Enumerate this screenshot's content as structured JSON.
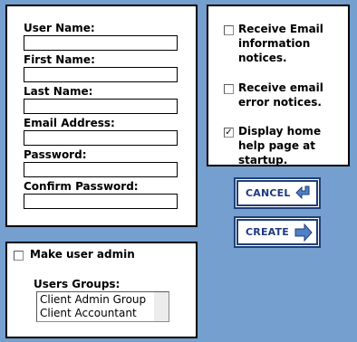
{
  "user_form": {
    "fields": [
      {
        "label": "User Name:",
        "value": ""
      },
      {
        "label": "First Name:",
        "value": ""
      },
      {
        "label": "Last Name:",
        "value": ""
      },
      {
        "label": "Email Address:",
        "value": ""
      },
      {
        "label": "Password:",
        "value": ""
      },
      {
        "label": "Confirm Password:",
        "value": ""
      }
    ]
  },
  "preferences": [
    {
      "label": "Receive Email information notices.",
      "checked": false
    },
    {
      "label": "Receive email error notices.",
      "checked": false
    },
    {
      "label": "Display home help page at startup.",
      "checked": true
    }
  ],
  "buttons": {
    "cancel": {
      "label": "CANCEL",
      "icon": "return-arrow-icon"
    },
    "create": {
      "label": "CREATE",
      "icon": "right-arrow-icon"
    }
  },
  "admin": {
    "make_admin_label": "Make user admin",
    "make_admin_checked": false,
    "groups_label": "Users Groups:",
    "groups": [
      "Client Admin Group",
      "Client Accountant"
    ]
  },
  "colors": {
    "background": "#749fcf",
    "button_text": "#1f3a80",
    "button_border": "#1e3f78",
    "arrow_fill": "#4f7fc4"
  }
}
